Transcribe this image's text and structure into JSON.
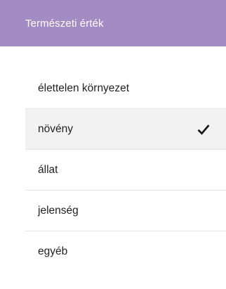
{
  "dialog": {
    "title": "Természeti érték",
    "header_color": "#a58bc4",
    "options": [
      {
        "label": "élettelen környezet",
        "selected": false
      },
      {
        "label": "növény",
        "selected": true
      },
      {
        "label": "állat",
        "selected": false
      },
      {
        "label": "jelenség",
        "selected": false
      },
      {
        "label": "egyéb",
        "selected": false
      }
    ],
    "selected_icon": "checkmark-icon"
  }
}
